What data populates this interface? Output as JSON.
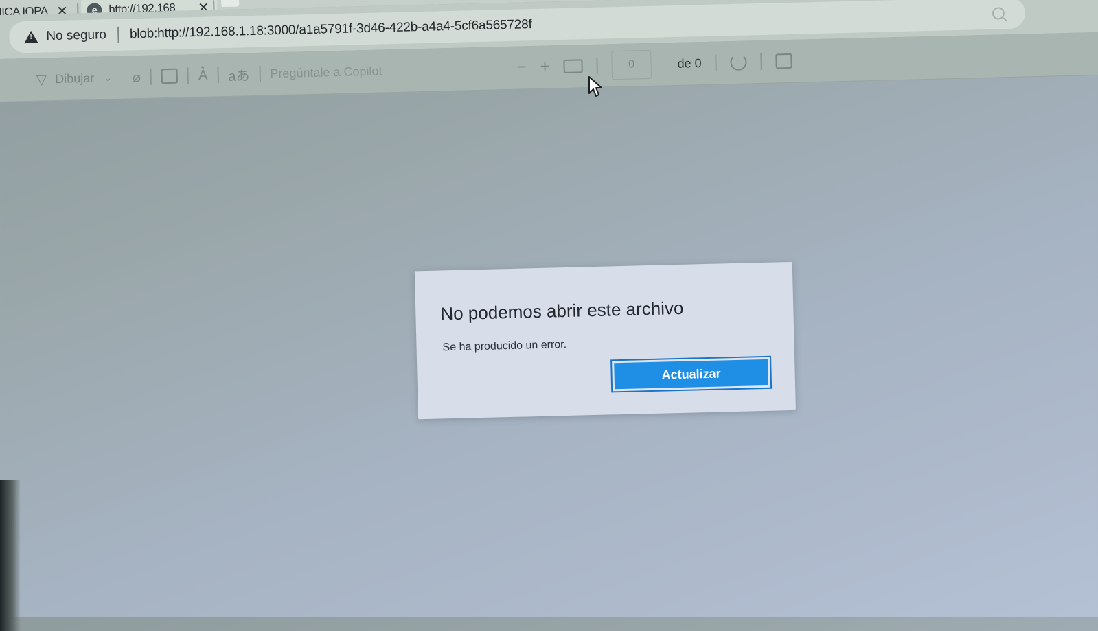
{
  "browser": {
    "tabs": [
      {
        "title": "NICA IOPA"
      },
      {
        "title": "http://192.168"
      }
    ],
    "address_bar": {
      "security_label": "No seguro",
      "url": "blob:http://192.168.1.18:3000/a1a5791f-3d46-422b-a4a4-5cf6a565728f"
    }
  },
  "pdf_toolbar": {
    "draw_label": "Dibujar",
    "copilot_placeholder": "Pregúntale a Copilot",
    "zoom_out": "−",
    "zoom_in": "+",
    "page_number": "0",
    "page_count": "de 0"
  },
  "dialog": {
    "title": "No podemos abrir este archivo",
    "message": "Se ha producido un error.",
    "button_label": "Actualizar"
  },
  "colors": {
    "accent": "#1f8fe6",
    "dialog_bg": "#d7dde9"
  }
}
